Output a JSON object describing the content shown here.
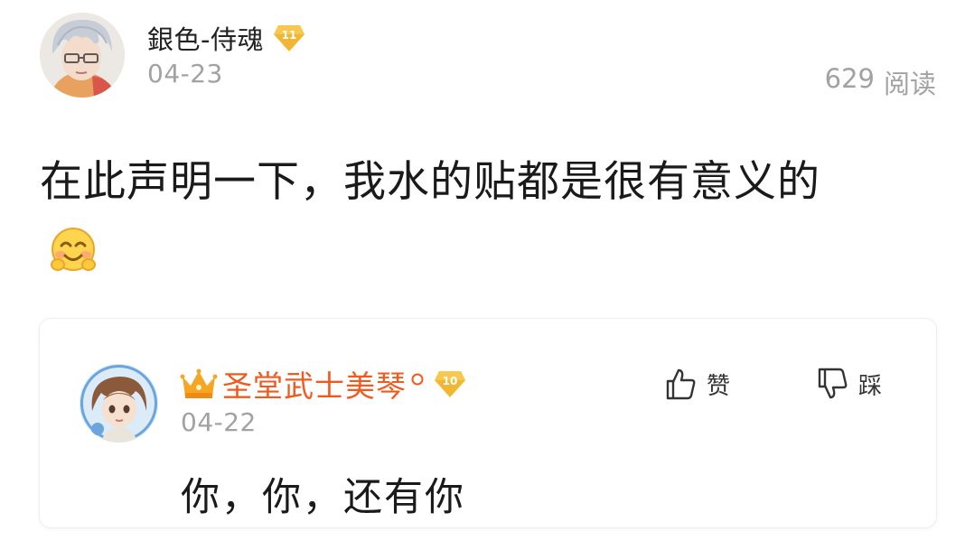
{
  "post": {
    "author_name": "銀色-侍魂",
    "author_level": "11",
    "date": "04-23",
    "read_count": "629",
    "read_label": "阅读",
    "content": "在此声明一下，我水的贴都是很有意义的",
    "emoji": "smiling-face-emoji"
  },
  "comment": {
    "author_name": "圣堂武士美琴",
    "author_level": "10",
    "date": "04-22",
    "content": "你，你，还有你",
    "like_label": "赞",
    "dislike_label": "踩"
  },
  "colors": {
    "commenter_name": "#f05a1f",
    "badge_gold": "#f1b733",
    "secondary_text": "#a2a2a2"
  }
}
